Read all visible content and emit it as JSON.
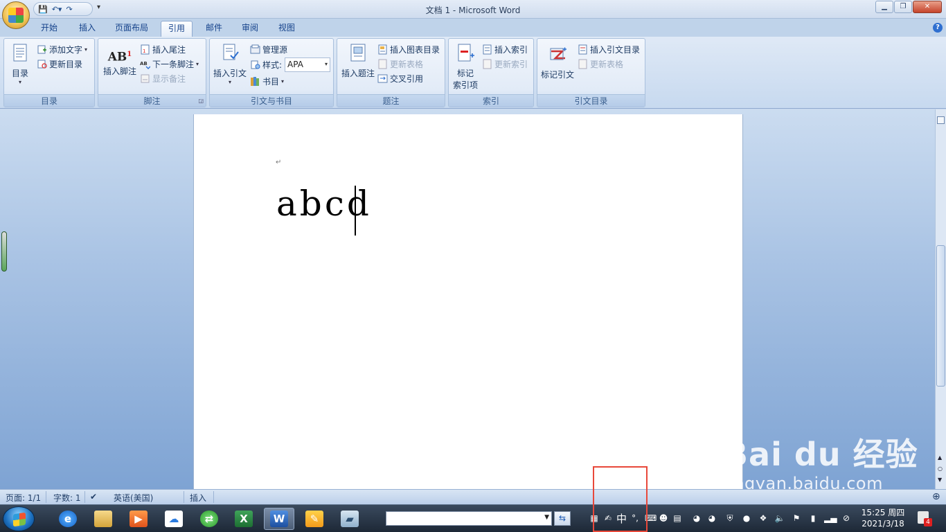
{
  "window": {
    "title": "文档 1 - Microsoft Word"
  },
  "tabs": [
    "开始",
    "插入",
    "页面布局",
    "引用",
    "邮件",
    "审阅",
    "视图"
  ],
  "active_tab": "引用",
  "ribbon": {
    "groups": {
      "toc": {
        "label": "目录",
        "toc_button": "目录",
        "add_text": "添加文字",
        "update_toc": "更新目录"
      },
      "footnotes": {
        "label": "脚注",
        "insert_footnote": "插入脚注",
        "insert_endnote": "插入尾注",
        "next_footnote": "下一条脚注",
        "show_notes": "显示备注",
        "ab_glyph": "AB",
        "sup_glyph": "1"
      },
      "citations": {
        "label": "引文与书目",
        "insert_citation": "插入引文",
        "manage_sources": "管理源",
        "style_label": "样式:",
        "style_value": "APA",
        "bibliography": "书目"
      },
      "captions": {
        "label": "题注",
        "insert_caption": "插入题注",
        "insert_table_of_figures": "插入图表目录",
        "update_table": "更新表格",
        "cross_reference": "交叉引用"
      },
      "index": {
        "label": "索引",
        "mark_entry_line1": "标记",
        "mark_entry_line2": "索引项",
        "insert_index": "插入索引",
        "update_index": "更新索引"
      },
      "toa": {
        "label": "引文目录",
        "mark_citation": "标记引文",
        "insert_toa": "插入引文目录",
        "update_table": "更新表格"
      }
    }
  },
  "document": {
    "paragraph_mark": "↵",
    "text": "abcd"
  },
  "statusbar": {
    "page": "页面: 1/1",
    "words": "字数: 1",
    "language": "英语(美国)",
    "mode": "插入"
  },
  "watermark": {
    "logo": "Bai du 经验",
    "url": "jingyan.baidu.com"
  },
  "taskbar": {
    "ime_char": "中",
    "clock_time": "15:25 周四",
    "clock_date": "2021/3/18",
    "notif_count": "4"
  },
  "colors": {
    "ribbon_text": "#15428b",
    "highlight_box": "#e8483a"
  }
}
